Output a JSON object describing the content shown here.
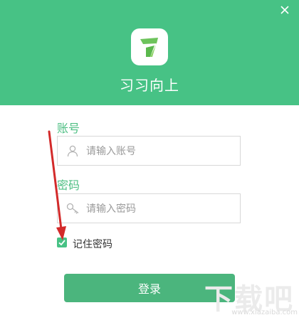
{
  "app": {
    "name": "习习向上"
  },
  "colors": {
    "brand": "#47c285",
    "button": "#4bb57d",
    "label": "#4fbf84",
    "annotation_arrow": "#d32a2a"
  },
  "login_form": {
    "account_label": "账号",
    "account_placeholder": "请输入账号",
    "password_label": "密码",
    "password_placeholder": "请输入密码",
    "remember_label": "记住密码",
    "remember_checked": true,
    "login_button": "登录"
  },
  "icons": [
    "close-icon",
    "app-logo",
    "user-icon",
    "key-icon",
    "checkmark-icon",
    "annotation-arrow"
  ],
  "watermark": {
    "text": "下载吧",
    "url": "www.xiazaiba.com"
  }
}
